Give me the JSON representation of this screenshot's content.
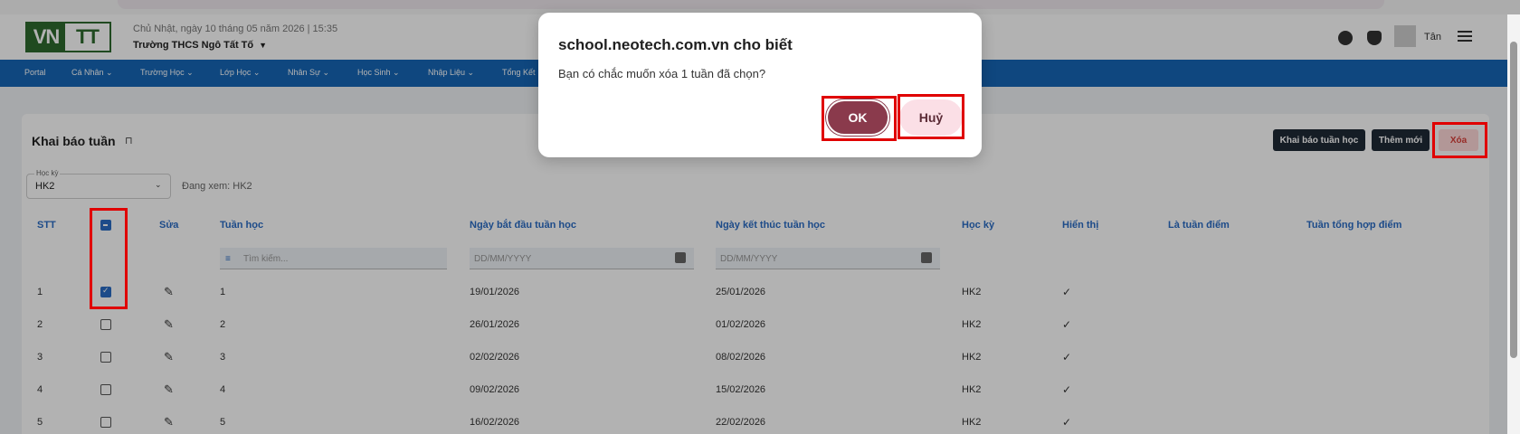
{
  "header": {
    "logo_left": "VN",
    "logo_right": "TT",
    "date": "Chủ Nhật, ngày 10 tháng 05 năm 2026 | 15:35",
    "school": "Trường THCS Ngô Tất Tố",
    "user": "Tân"
  },
  "nav": [
    "Portal",
    "Cá Nhân",
    "Trường Học",
    "Lớp Học",
    "Nhân Sự",
    "Học Sinh",
    "Nhập Liệu",
    "Tổng Kết"
  ],
  "page": {
    "title": "Khai báo tuần",
    "btn_declare": "Khai báo tuần học",
    "btn_add": "Thêm mới",
    "btn_delete": "Xóa"
  },
  "filter": {
    "semester_label": "Học kỳ",
    "semester_value": "HK2",
    "viewing": "Đang xem: HK2",
    "search_placeholder": "Tìm kiếm...",
    "date_placeholder_start": "DD/MM/YYYY",
    "date_placeholder_end": "DD/MM/YYYY"
  },
  "table": {
    "headers": {
      "stt": "STT",
      "edit": "Sửa",
      "week": "Tuần học",
      "start": "Ngày bắt đầu tuần học",
      "end": "Ngày kết thúc tuần học",
      "semester": "Học kỳ",
      "show": "Hiển thị",
      "grade_week": "Là tuần điểm",
      "summary_week": "Tuần tổng hợp điểm"
    },
    "rows": [
      {
        "stt": "1",
        "week": "1",
        "start": "19/01/2026",
        "end": "25/01/2026",
        "semester": "HK2",
        "show": "✓",
        "checked": true
      },
      {
        "stt": "2",
        "week": "2",
        "start": "26/01/2026",
        "end": "01/02/2026",
        "semester": "HK2",
        "show": "✓",
        "checked": false
      },
      {
        "stt": "3",
        "week": "3",
        "start": "02/02/2026",
        "end": "08/02/2026",
        "semester": "HK2",
        "show": "✓",
        "checked": false
      },
      {
        "stt": "4",
        "week": "4",
        "start": "09/02/2026",
        "end": "15/02/2026",
        "semester": "HK2",
        "show": "✓",
        "checked": false
      },
      {
        "stt": "5",
        "week": "5",
        "start": "16/02/2026",
        "end": "22/02/2026",
        "semester": "HK2",
        "show": "✓",
        "checked": false
      }
    ]
  },
  "dialog": {
    "title": "school.neotech.com.vn cho biết",
    "message": "Bạn có chắc muốn xóa 1 tuần đã chọn?",
    "ok": "OK",
    "cancel": "Huỷ"
  },
  "colors": {
    "nav_bg": "#1666b6",
    "highlight": "#e00000",
    "ok_button": "#8a3a4c",
    "cancel_button": "#fbdfe6"
  }
}
